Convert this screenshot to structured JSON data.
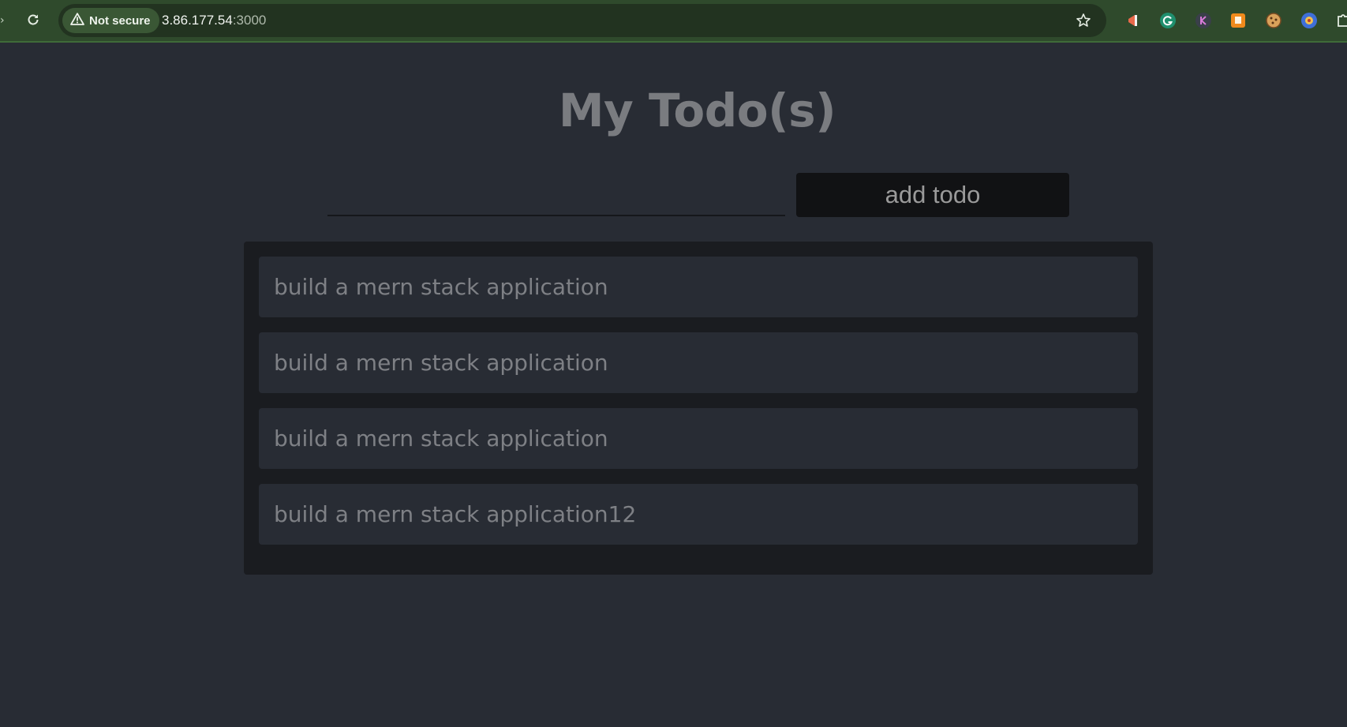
{
  "browser": {
    "security_label": "Not secure",
    "url_host": "3.86.177.54",
    "url_port": ":3000",
    "icons": [
      "reload-icon",
      "warning-icon",
      "star-icon",
      "megaphone-extension-icon",
      "grammarly-extension-icon",
      "k-extension-icon",
      "fist-extension-icon",
      "cookie-extension-icon",
      "eye-extension-icon",
      "puzzle-extensions-icon"
    ]
  },
  "app": {
    "title": "My Todo(s)",
    "input": {
      "value": "",
      "placeholder": ""
    },
    "add_button_label": "add todo",
    "todos": [
      {
        "text": "build a mern stack application"
      },
      {
        "text": "build a mern stack application"
      },
      {
        "text": "build a mern stack application"
      },
      {
        "text": "build a mern stack application12"
      }
    ]
  },
  "colors": {
    "page_background": "#282c34",
    "panel_background": "#1a1c20",
    "button_background": "#111214",
    "browser_frame": "#2f4a2c"
  }
}
